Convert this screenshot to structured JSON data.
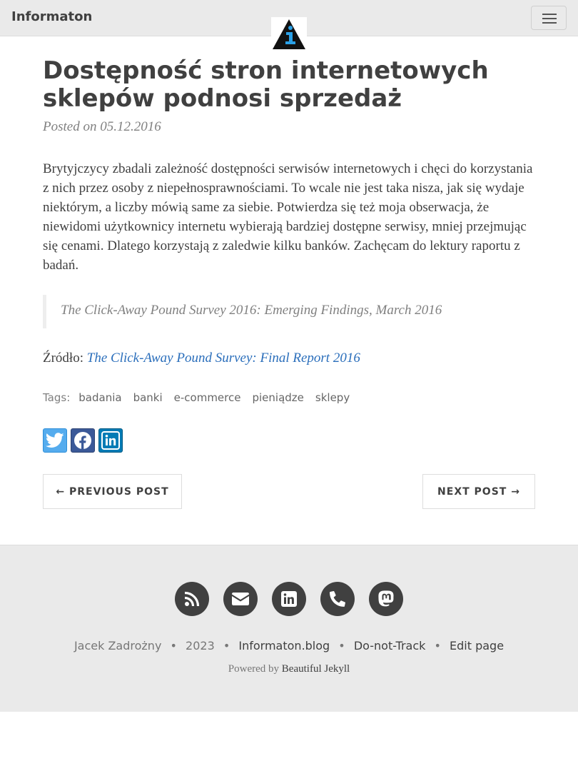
{
  "navbar": {
    "brand": "Informaton",
    "logo_icon": "informaton-logo-icon",
    "menu_icon": "hamburger-menu-icon"
  },
  "post": {
    "title": "Dostępność stron internetowych sklepów podnosi sprzedaż",
    "meta": "Posted on 05.12.2016",
    "body": "Brytyjczycy zbadali zależność dostępności serwisów internetowych i chęci do korzystania z nich przez osoby z niepełnosprawnościami. To wcale nie jest taka nisza, jak się wydaje niektórym, a liczby mówią same za siebie. Potwierdza się też moja obserwacja, że niewidomi użytkownicy internetu wybierają bardziej dostępne serwisy, mniej przejmując się cenami. Dlatego korzystają z zaledwie kilku banków. Zachęcam do lektury raportu z badań.",
    "quote": "The Click-Away Pound Survey 2016: Emerging Findings, March 2016",
    "source_label": "Źródło:",
    "source_link": "The Click-Away Pound Survey: Final Report 2016"
  },
  "tags": {
    "label": "Tags:",
    "items": [
      "badania",
      "banki",
      "e-commerce",
      "pieniądze",
      "sklepy"
    ]
  },
  "share": {
    "icons": [
      "twitter-icon",
      "facebook-icon",
      "linkedin-icon"
    ]
  },
  "pager": {
    "prev": "← PREVIOUS POST",
    "next": "NEXT POST →"
  },
  "footer": {
    "social_icons": [
      "rss-icon",
      "envelope-icon",
      "linkedin-icon",
      "phone-icon",
      "mastodon-icon"
    ],
    "author": "Jacek Zadrożny",
    "year": "2023",
    "site": "Informaton.blog",
    "dnt": "Do-not-Track",
    "edit": "Edit page",
    "powered_prefix": "Powered by ",
    "powered_link": "Beautiful Jekyll",
    "sep": "•"
  },
  "colors": {
    "navbar_bg": "#eaeaea",
    "link": "#2a6ebb",
    "text": "#404040",
    "footer_icon": "#404040"
  }
}
